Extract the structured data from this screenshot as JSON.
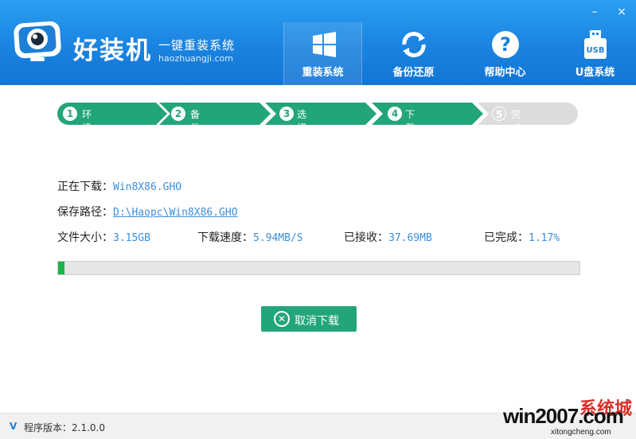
{
  "header": {
    "brand": "好装机",
    "slogan": "一键重装系统",
    "site": "haozhuangji.com",
    "nav": [
      {
        "label": "重装系统",
        "icon": "windows-icon",
        "active": true
      },
      {
        "label": "备份还原",
        "icon": "sync-icon",
        "active": false
      },
      {
        "label": "帮助中心",
        "icon": "help-icon",
        "active": false
      },
      {
        "label": "U盘系统",
        "icon": "usb-icon",
        "active": false
      }
    ],
    "window_controls": {
      "minimize": "–",
      "close": "×"
    }
  },
  "steps": [
    {
      "num": "1",
      "label": "环境检测",
      "state": "done"
    },
    {
      "num": "2",
      "label": "备份资料",
      "state": "done"
    },
    {
      "num": "3",
      "label": "选择系统",
      "state": "done"
    },
    {
      "num": "4",
      "label": "下载文件",
      "state": "current"
    },
    {
      "num": "5",
      "label": "完成重启",
      "state": "pending"
    }
  ],
  "download": {
    "downloading_label": "正在下载：",
    "downloading_value": "Win8X86.GHO",
    "path_label": "保存路径：",
    "path_value": "D:\\Haopc\\Win8X86.GHO",
    "size_label": "文件大小：",
    "size_value": "3.15GB",
    "speed_label": "下载速度：",
    "speed_value": "5.94MB/S",
    "received_label": "已接收：",
    "received_value": "37.69MB",
    "done_label": "已完成：",
    "done_value": "1.17%",
    "progress_percent": 1.17
  },
  "cancel_button": {
    "label": "取消下载",
    "icon": "cancel-circle-icon"
  },
  "footer": {
    "v_mark": "V",
    "version": "程序版本：2.1.0.0"
  },
  "watermark": {
    "main": "win2007.com",
    "cn": "系统城",
    "sub": "xitongcheng.com"
  },
  "colors": {
    "header": "#1a83e0",
    "step_done": "#23a57a",
    "step_pending": "#dcdcdc",
    "value_text": "#3c8fd8",
    "progress": "#1fb24a",
    "button": "#22a57a"
  }
}
